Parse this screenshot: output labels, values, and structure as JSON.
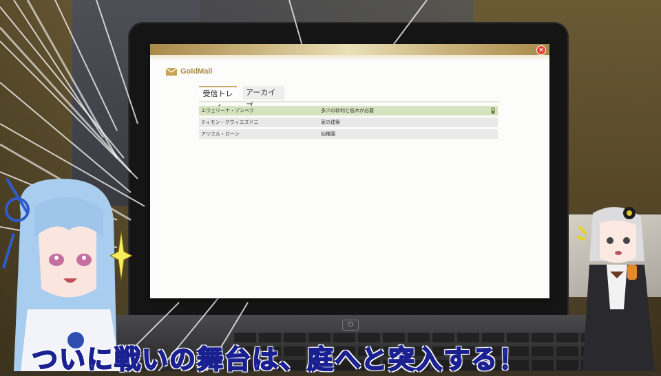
{
  "window": {
    "app_name": "GoldMail",
    "close_label": "×"
  },
  "tabs": [
    {
      "label": "受信トレイ",
      "active": true
    },
    {
      "label": "アーカイブ",
      "active": false
    }
  ],
  "mails": [
    {
      "sender": "エウェリーナ・ゾンベク",
      "subject": "多少の砂利と低木が必要",
      "attachment": true,
      "selected": true
    },
    {
      "sender": "ティモン・グヴィエズドニ",
      "subject": "家の建築",
      "attachment": false,
      "selected": false
    },
    {
      "sender": "アリエル・ローン",
      "subject": "幼稚園",
      "attachment": false,
      "selected": false
    }
  ],
  "laptop": {
    "power_symbol": "⏻"
  },
  "caption": "ついに戦いの舞台は、庭へと突入する！",
  "colors": {
    "header_gold": "#c9b27a",
    "logo_gold": "#a88a48",
    "selected_row": "#d6e3bf",
    "close_red": "#e53d2e",
    "caption_fill": "#5a66e6",
    "caption_stroke": "#1a2090"
  },
  "icons": {
    "logo": "envelope-icon",
    "close": "close-icon",
    "attachment": "attachment-icon"
  }
}
